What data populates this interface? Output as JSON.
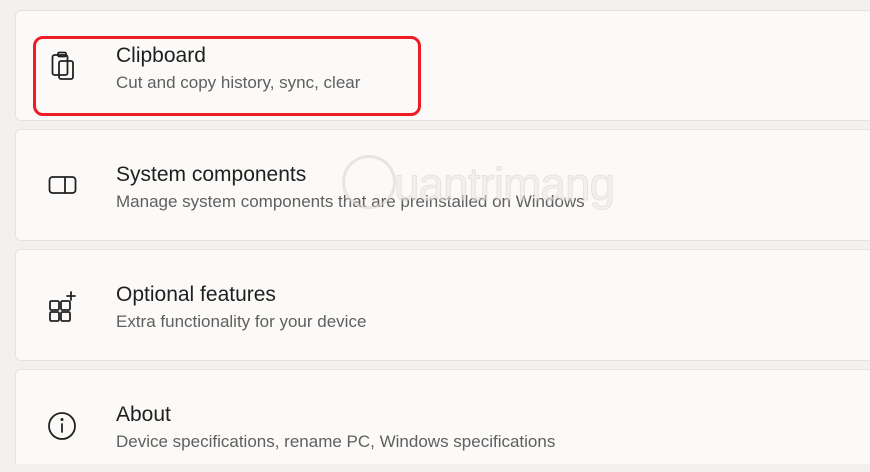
{
  "settings": {
    "items": [
      {
        "title": "Clipboard",
        "subtitle": "Cut and copy history, sync, clear",
        "icon": "clipboard-icon",
        "highlighted": true
      },
      {
        "title": "System components",
        "subtitle": "Manage system components that are preinstalled on Windows",
        "icon": "system-components-icon",
        "highlighted": false
      },
      {
        "title": "Optional features",
        "subtitle": "Extra functionality for your device",
        "icon": "optional-features-icon",
        "highlighted": false
      },
      {
        "title": "About",
        "subtitle": "Device specifications, rename PC, Windows specifications",
        "icon": "info-icon",
        "highlighted": false
      }
    ]
  },
  "colors": {
    "background": "#f3f1ee",
    "card": "#fbfaf8",
    "title_text": "#1f1f1f",
    "subtitle_text": "#5f5f5f",
    "highlight_border": "#ee1c25"
  },
  "watermark": {
    "text": "uantrimang",
    "icon": "lightbulb-icon"
  }
}
